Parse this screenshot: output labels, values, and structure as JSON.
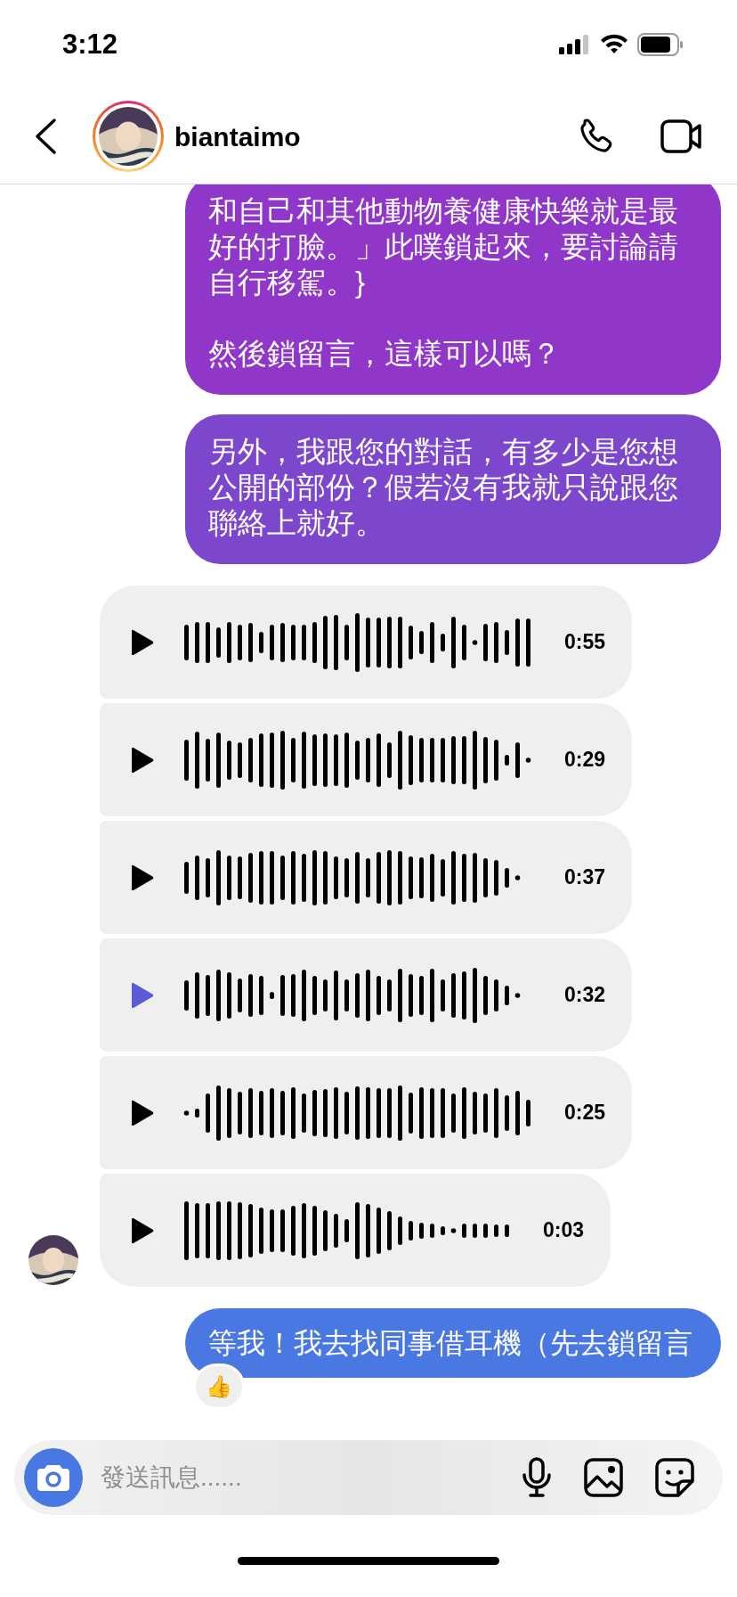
{
  "status_bar": {
    "time": "3:12"
  },
  "header": {
    "username": "biantaimo"
  },
  "messages": [
    {
      "kind": "text",
      "paragraphs": [
        "和自己和其他動物養健康快樂就是最好的打臉。」此噗鎖起來，要討論請自行移駕。}",
        "然後鎖留言，這樣可以嗎？"
      ],
      "color": "#9037c9"
    },
    {
      "kind": "text",
      "paragraphs": [
        "另外，我跟您的對話，有多少是您想公開的部份？假若沒有我就只說跟您聯絡上就好。"
      ],
      "color": "#7c47cc"
    },
    {
      "kind": "voice",
      "duration": "0:55",
      "active": false
    },
    {
      "kind": "voice",
      "duration": "0:29",
      "active": false
    },
    {
      "kind": "voice",
      "duration": "0:37",
      "active": false
    },
    {
      "kind": "voice",
      "duration": "0:32",
      "active": true
    },
    {
      "kind": "voice",
      "duration": "0:25",
      "active": false
    },
    {
      "kind": "voice",
      "duration": "0:03",
      "active": false
    },
    {
      "kind": "text",
      "paragraphs": [
        "等我！我去找同事借耳機（先去鎖留言"
      ],
      "color": "#4a78e3",
      "reaction": "👍"
    }
  ],
  "composer": {
    "placeholder": "發送訊息......"
  }
}
